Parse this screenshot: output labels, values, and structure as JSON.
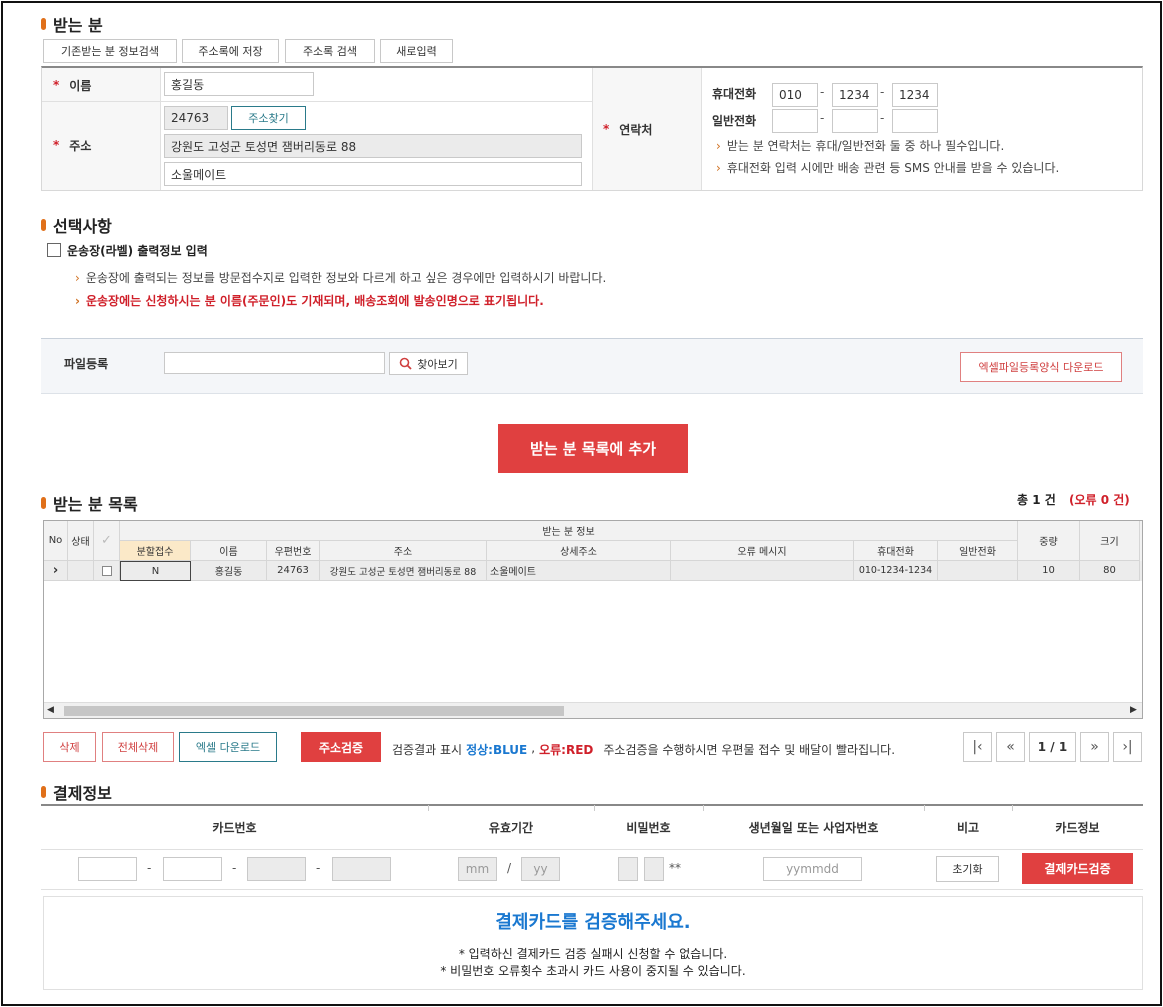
{
  "recipient": {
    "title": "받는 분",
    "buttons": [
      "기존받는 분 정보검색",
      "주소록에 저장",
      "주소록 검색",
      "새로입력"
    ],
    "name_label": "이름",
    "name_value": "홍길동",
    "address_label": "주소",
    "postal_code": "24763",
    "find_address_button": "주소찾기",
    "address_line1": "강원도 고성군 토성면 잼버리동로 88",
    "address_line2": "소울메이트",
    "contact_label": "연락처",
    "mobile_label": "휴대전화",
    "mobile": [
      "010",
      "1234",
      "1234"
    ],
    "phone_label": "일반전화",
    "phone": [
      "",
      "",
      ""
    ],
    "dash": "-",
    "notes": [
      "받는 분 연락처는 휴대/일반전화 둘 중 하나 필수입니다.",
      "휴대전화 입력 시에만 배송 관련 등 SMS 안내를 받을 수 있습니다."
    ]
  },
  "options": {
    "title": "선택사항",
    "checkbox_label": "운송장(라벨) 출력정보 입력",
    "checkbox_checked": false,
    "note1": "운송장에 출력되는 정보를 방문접수지로 입력한 정보와 다르게 하고 싶은 경우에만 입력하시기 바랍니다.",
    "note2": "운송장에는 신청하시는 분 이름(주문인)도 기재되며, 배송조회에 발송인명으로 표기됩니다."
  },
  "file": {
    "label": "파일등록",
    "input_value": "",
    "browse_button": "찾아보기",
    "download_template_button": "엑셀파일등록양식 다운로드"
  },
  "add_to_list_button": "받는 분 목록에 추가",
  "list": {
    "title": "받는 분 목록",
    "total_text": "총 1 건",
    "error_text": "(오류 0 건)",
    "headers": {
      "no": "No",
      "status": "상태",
      "group": "받는 분 정보",
      "split": "분할접수",
      "name": "이름",
      "postal": "우편번호",
      "address": "주소",
      "detail": "상세주소",
      "error": "오류 메시지",
      "mobile": "휴대전화",
      "phone": "일반전화",
      "weight": "중량",
      "size": "크기"
    },
    "rows": [
      {
        "split": "N",
        "name": "홍길동",
        "postal": "24763",
        "address": "강원도 고성군 토성면 잼버리동로 88",
        "detail": "소울메이트",
        "error": "",
        "mobile": "010-1234-1234",
        "phone": "",
        "weight": "10",
        "size": "80"
      }
    ],
    "delete_button": "삭제",
    "delete_all_button": "전체삭제",
    "excel_download_button": "엑셀 다운로드",
    "verify_address_button": "주소검증",
    "verify_legend_prefix": "검증결과 표시",
    "normal_label": "정상:BLUE",
    "error_label": "오류:RED",
    "verify_note": "주소검증을 수행하시면 우편물 접수 및 배달이 빨라집니다.",
    "page_text": "1 / 1"
  },
  "payment": {
    "title": "결제정보",
    "headers": [
      "카드번호",
      "유효기간",
      "비밀번호",
      "생년월일 또는 사업자번호",
      "비고",
      "카드정보"
    ],
    "mm_placeholder": "mm",
    "yy_placeholder": "yy",
    "slash": "/",
    "pw_suffix": "**",
    "birth_placeholder": "yymmdd",
    "reset_button": "초기화",
    "verify_button": "결제카드검증",
    "message_title": "결제카드를 검증해주세요.",
    "message_lines": [
      "* 입력하신 결제카드 검증 실패시 신청할 수 없습니다.",
      "* 비밀번호 오류횟수 초과시 카드 사용이 중지될 수 있습니다."
    ]
  },
  "colors": {
    "accent": "#e0701a",
    "red_button": "#e04040",
    "blue": "#1a78d0",
    "red_text": "#d0202a",
    "teal": "#2a7a8a"
  }
}
